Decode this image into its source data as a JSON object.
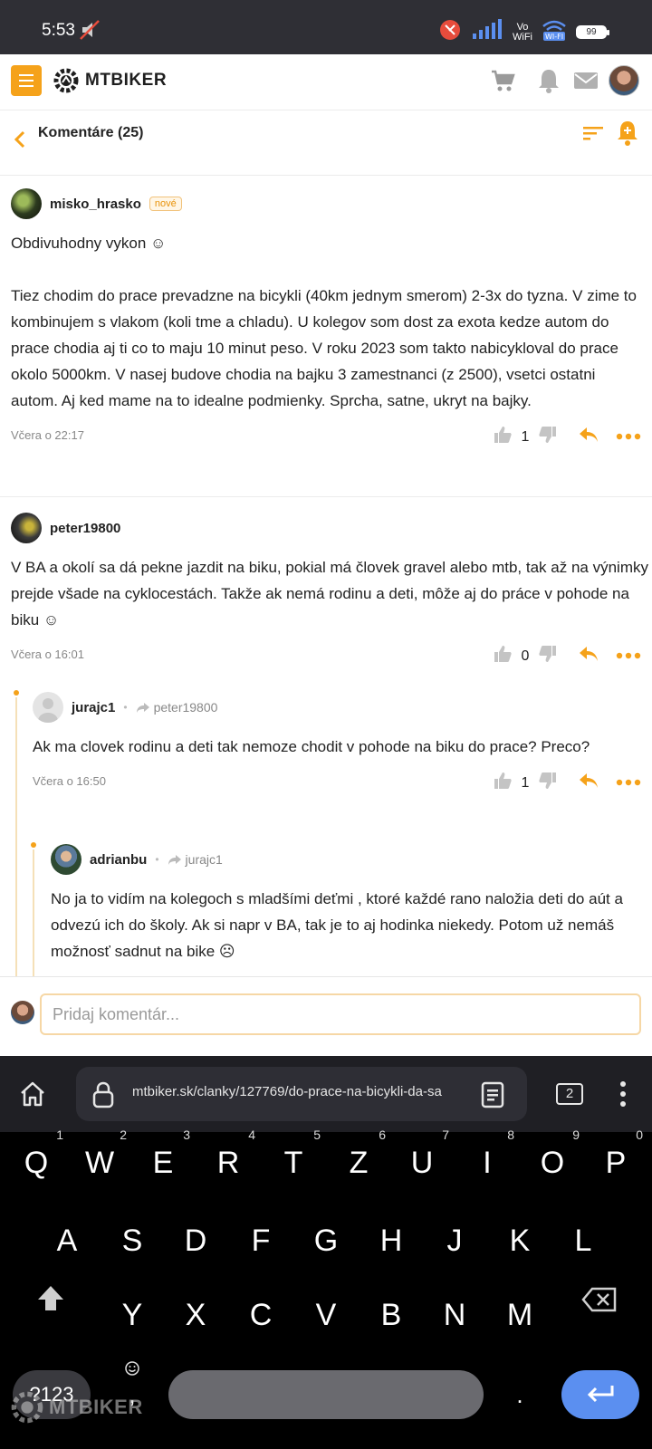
{
  "status_bar": {
    "time": "5:53",
    "vowifi_top": "Vo",
    "vowifi_bottom": "WiFi",
    "battery": "99"
  },
  "header": {
    "logo_text": "MTBIKER",
    "brand_color": "#f5a21a"
  },
  "subheader": {
    "title": "Komentáre (25)"
  },
  "comments": [
    {
      "author": "misko_hrasko",
      "badge": "nové",
      "text": "Obdivuhodny vykon ☺\n\nTiez chodim do prace prevadzne na bicykli (40km jednym smerom) 2-3x do tyzna. V zime to kombinujem s vlakom (koli tme a chladu). U kolegov som dost za exota kedze autom do prace chodia aj ti co to maju 10 minut peso. V roku 2023 som takto nabicykloval do prace okolo 5000km. V nasej budove chodia na bajku 3 zamestnanci (z 2500), vsetci ostatni autom. Aj ked mame na to idealne podmienky. Sprcha, satne, ukryt na bajky.",
      "time": "Včera o 22:17",
      "votes": "1"
    },
    {
      "author": "peter19800",
      "text": "V BA a okolí sa dá pekne jazdit na biku, pokial má človek gravel alebo mtb, tak až na výnimky prejde všade na cyklocestách. Takže ak nemá rodinu a deti, môže aj do práce v pohode na biku ☺",
      "time": "Včera o 16:01",
      "votes": "0"
    },
    {
      "author": "jurajc1",
      "reply_to": "peter19800",
      "text": "Ak ma clovek rodinu a deti tak nemoze chodit v pohode na biku do prace? Preco?",
      "time": "Včera o 16:50",
      "votes": "1"
    },
    {
      "author": "adrianbu",
      "reply_to": "jurajc1",
      "text": "No ja to vidím na kolegoch s mladšími deťmi , ktoré každé rano naložia deti do aút a odvezú ich do školy. Ak si napr v BA, tak je to aj hodinka niekedy. Potom už nemáš možnosť sadnut na bike ☹"
    }
  ],
  "comment_input": {
    "placeholder": "Pridaj komentár..."
  },
  "browser": {
    "url": "mtbiker.sk/clanky/127769/do-prace-na-bicykli-da-sa",
    "tab_count": "2"
  },
  "keyboard": {
    "row1": [
      {
        "k": "Q",
        "n": "1"
      },
      {
        "k": "W",
        "n": "2"
      },
      {
        "k": "E",
        "n": "3"
      },
      {
        "k": "R",
        "n": "4"
      },
      {
        "k": "T",
        "n": "5"
      },
      {
        "k": "Z",
        "n": "6"
      },
      {
        "k": "U",
        "n": "7"
      },
      {
        "k": "I",
        "n": "8"
      },
      {
        "k": "O",
        "n": "9"
      },
      {
        "k": "P",
        "n": "0"
      }
    ],
    "row2": [
      "A",
      "S",
      "D",
      "F",
      "G",
      "H",
      "J",
      "K",
      "L"
    ],
    "row3": [
      "Y",
      "X",
      "C",
      "V",
      "B",
      "N",
      "M"
    ],
    "num_key": "?123",
    "comma_key": ",",
    "period_key": ".",
    "watermark": "MTBIKER"
  }
}
